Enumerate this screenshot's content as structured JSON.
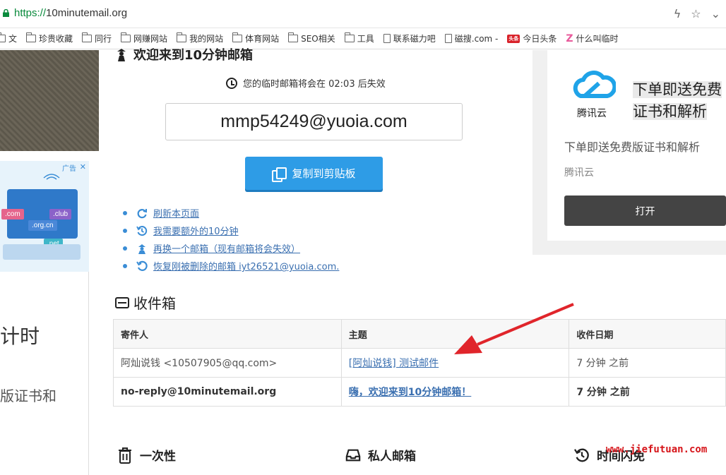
{
  "browser": {
    "url_scheme": "https://",
    "url_host": "10minutemail.org",
    "bookmarks": [
      {
        "label": "文",
        "icon": "folder-icon"
      },
      {
        "label": "珍贵收藏",
        "icon": "folder-icon"
      },
      {
        "label": "同行",
        "icon": "folder-icon"
      },
      {
        "label": "网赚网站",
        "icon": "folder-icon"
      },
      {
        "label": "我的网站",
        "icon": "folder-icon"
      },
      {
        "label": "体育网站",
        "icon": "folder-icon"
      },
      {
        "label": "SEO相关",
        "icon": "folder-icon"
      },
      {
        "label": "工具",
        "icon": "folder-icon"
      },
      {
        "label": "联系磁力吧",
        "icon": "page-icon"
      },
      {
        "label": "磁搜.com -",
        "icon": "page-icon"
      },
      {
        "label": "今日头条",
        "icon": "toutiao-icon",
        "badge": "头条"
      },
      {
        "label": "什么叫临时",
        "icon": "z-icon",
        "badge": "Z"
      }
    ]
  },
  "main": {
    "welcome": "欢迎来到10分钟邮箱",
    "timer_text": "您的临时邮箱将会在 02:03 后失效",
    "email": "mmp54249@yuoia.com",
    "copy_button": "复制到剪贴板",
    "links": [
      {
        "label": "刷新本页面",
        "icon": "refresh-icon"
      },
      {
        "label": "我需要额外的10分钟",
        "icon": "history-icon"
      },
      {
        "label": "再换一个邮箱（现有邮箱将会失效）",
        "icon": "spy-icon"
      },
      {
        "label": "恢复刚被删除的邮箱 iyt26521@yuoia.com.",
        "icon": "undo-icon"
      }
    ],
    "inbox_title": "收件箱",
    "inbox_headers": [
      "寄件人",
      "主题",
      "收件日期"
    ],
    "inbox_rows": [
      {
        "sender": "阿灿说钱 <10507905@qq.com>",
        "subject": "[阿灿说钱] 测试邮件",
        "date": "7 分钟 之前",
        "unread": false
      },
      {
        "sender": "no-reply@10minutemail.org",
        "subject": "嗨，欢迎来到10分钟邮箱！",
        "date": "7 分钟 之前",
        "unread": true
      }
    ],
    "features": [
      {
        "label": "一次性",
        "icon": "trash-icon"
      },
      {
        "label": "私人邮箱",
        "icon": "inbox-icon"
      },
      {
        "label": "时间闪免",
        "icon": "history-icon"
      }
    ]
  },
  "left": {
    "ad_label": "广告",
    "ad_chips": [
      ".com",
      ".club",
      ".org.cn",
      ".net"
    ],
    "big_text": "计时",
    "small_text": "版证书和"
  },
  "right_ad": {
    "brand": "腾讯云",
    "headline_1": "下单即送免费",
    "headline_2": "证书和解析",
    "description": "下单即送免费版证书和解析",
    "brand_line": "腾讯云",
    "button": "打开"
  },
  "watermark": "www.jiefutuan.com",
  "colors": {
    "accent": "#2e9ce6",
    "link": "#3a6fb0",
    "arrow": "#e0252b",
    "scheme": "#0a8a3c"
  }
}
